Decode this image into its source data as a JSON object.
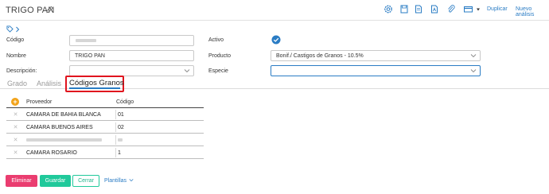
{
  "header": {
    "title": "TRIGO PAN",
    "toolbar_icons": [
      "settings-icon",
      "save-icon",
      "document-icon",
      "pdf-icon",
      "attachment-icon",
      "card-icon"
    ],
    "duplicate_label": "Duplicar",
    "new_analysis_label": "Nuevo análisis"
  },
  "form": {
    "codigo_label": "Código",
    "nombre_label": "Nombre",
    "nombre_value": "TRIGO PAN",
    "descripcion_label": "Descripción:",
    "activo_label": "Activo",
    "producto_label": "Producto",
    "producto_value": "Bonif./ Castigos de Granos - 10.5%",
    "especie_label": "Especie"
  },
  "tabs": [
    {
      "label": "Grado"
    },
    {
      "label": "Análisis"
    },
    {
      "label": "Códigos Granos"
    }
  ],
  "table": {
    "headers": [
      "Proveedor",
      "Código"
    ],
    "rows": [
      {
        "proveedor": "CAMARA DE BAHIA BLANCA",
        "codigo": "01"
      },
      {
        "proveedor": "CAMARA BUENOS AIRES",
        "codigo": "02"
      },
      {
        "proveedor": "",
        "codigo": ""
      },
      {
        "proveedor": "CAMARA ROSARIO",
        "codigo": "1"
      }
    ]
  },
  "footer": {
    "delete_label": "Eliminar",
    "save_label": "Guardar",
    "close_label": "Cerrar",
    "templates_label": "Plantillas"
  },
  "colors": {
    "accent": "#2a7cc4",
    "delete": "#ea3d70",
    "save": "#20c99b",
    "highlight": "#e0141e",
    "add": "#f2a31a"
  }
}
